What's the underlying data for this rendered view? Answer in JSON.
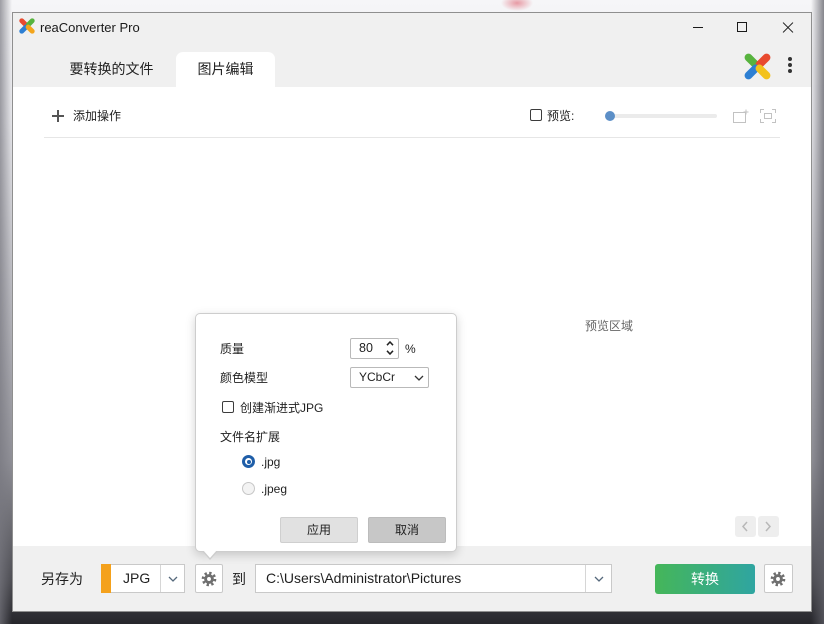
{
  "window": {
    "title": "reaConverter Pro"
  },
  "tabs": [
    {
      "label": "要转换的文件",
      "active": false
    },
    {
      "label": "图片编辑",
      "active": true
    }
  ],
  "toolbar": {
    "add_operation_label": "添加操作",
    "preview_label": "预览:",
    "preview_checked": false,
    "zoom_slider_value": 0
  },
  "preview": {
    "placeholder": "预览区域"
  },
  "jpg_options": {
    "quality_label": "质量",
    "quality_value": "80",
    "quality_unit": "%",
    "color_model_label": "颜色模型",
    "color_model_value": "YCbCr",
    "progressive_label": "创建渐进式JPG",
    "progressive_checked": false,
    "extension_label": "文件名扩展",
    "extensions": [
      {
        "label": ".jpg",
        "selected": true
      },
      {
        "label": ".jpeg",
        "selected": false
      }
    ],
    "apply_label": "应用",
    "cancel_label": "取消"
  },
  "output_bar": {
    "save_as_label": "另存为",
    "format_value": "JPG",
    "to_label": "到",
    "output_path": "C:\\Users\\Administrator\\Pictures",
    "convert_label": "转换"
  },
  "icons": {
    "app_logo": "reaconverter-logo-icon",
    "window_controls": [
      "minimize-icon",
      "maximize-icon",
      "close-icon"
    ],
    "menu": "more-vertical-icon",
    "add_operation": "plus-icon",
    "zoom_buttons": [
      "frame-plus-icon",
      "fit-screen-icon"
    ],
    "navigation": [
      "chevron-left-icon",
      "chevron-right-icon"
    ],
    "settings": "gear-icon",
    "dropdown": "chevron-down-icon"
  },
  "colors": {
    "format_badge": "#f4a11c",
    "convert_start": "#45b659",
    "convert_end": "#2fa5a1",
    "slider_handle": "#5c8fc7",
    "accent": "#1f5ea8"
  }
}
